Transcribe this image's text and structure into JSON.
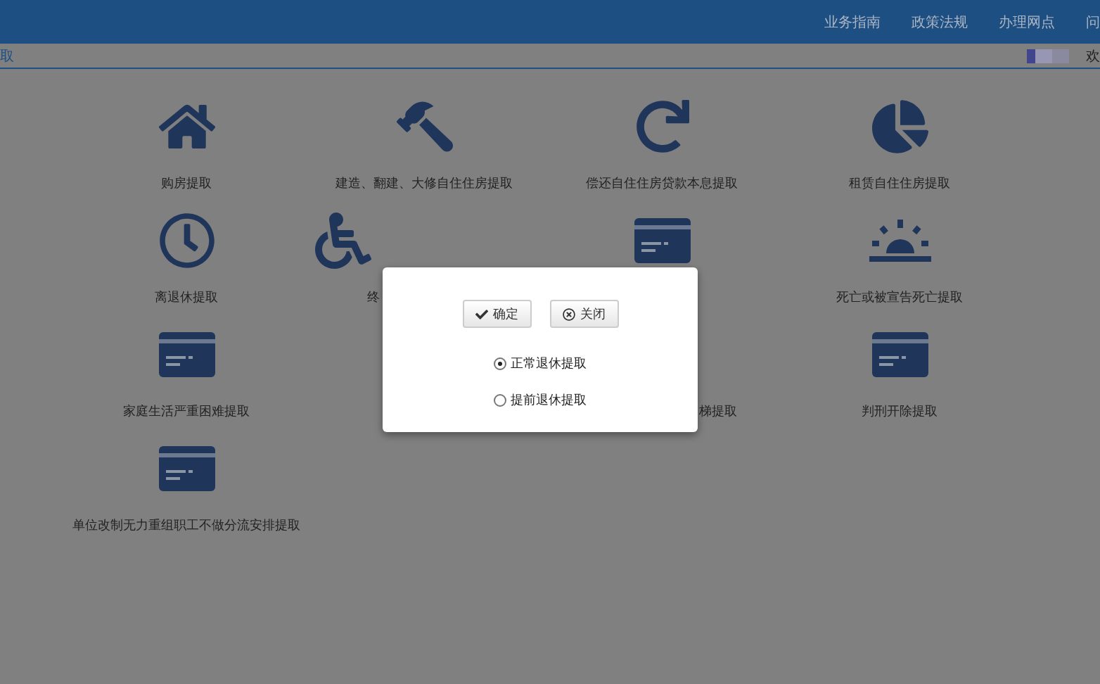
{
  "header": {
    "nav": [
      "业务指南",
      "政策法规",
      "办理网点",
      "问"
    ]
  },
  "subbar": {
    "breadcrumb": "取",
    "greeting": "欢"
  },
  "items": [
    {
      "kind": "tile",
      "label": "购房提取"
    },
    {
      "kind": "tile",
      "label": "建造、翻建、大修自住住房提取"
    },
    {
      "kind": "tile",
      "label": "偿还自住住房贷款本息提取"
    },
    {
      "kind": "tile",
      "label": "租赁自住住房提取"
    },
    {
      "kind": "tile",
      "label": "离退休提取"
    },
    {
      "kind": "cut_end",
      "label": "终"
    },
    {
      "kind": "icon"
    },
    {
      "kind": "tile",
      "label": "死亡或被宣告死亡提取"
    },
    {
      "kind": "tile",
      "label": "家庭生活严重困难提取"
    },
    {
      "kind": "cut_start",
      "label": "梯提取"
    },
    {
      "kind": "tile",
      "label": "判刑开除提取"
    },
    {
      "kind": "tile",
      "label": "单位改制无力重组职工不做分流安排提取"
    }
  ],
  "dialog": {
    "buttons": [
      {
        "kind": "confirm",
        "label": "确定"
      },
      {
        "kind": "close",
        "label": "关闭"
      }
    ],
    "options": [
      {
        "label": "正常退休提取",
        "selected": true
      },
      {
        "label": "提前退休提取",
        "selected": false
      }
    ]
  }
}
